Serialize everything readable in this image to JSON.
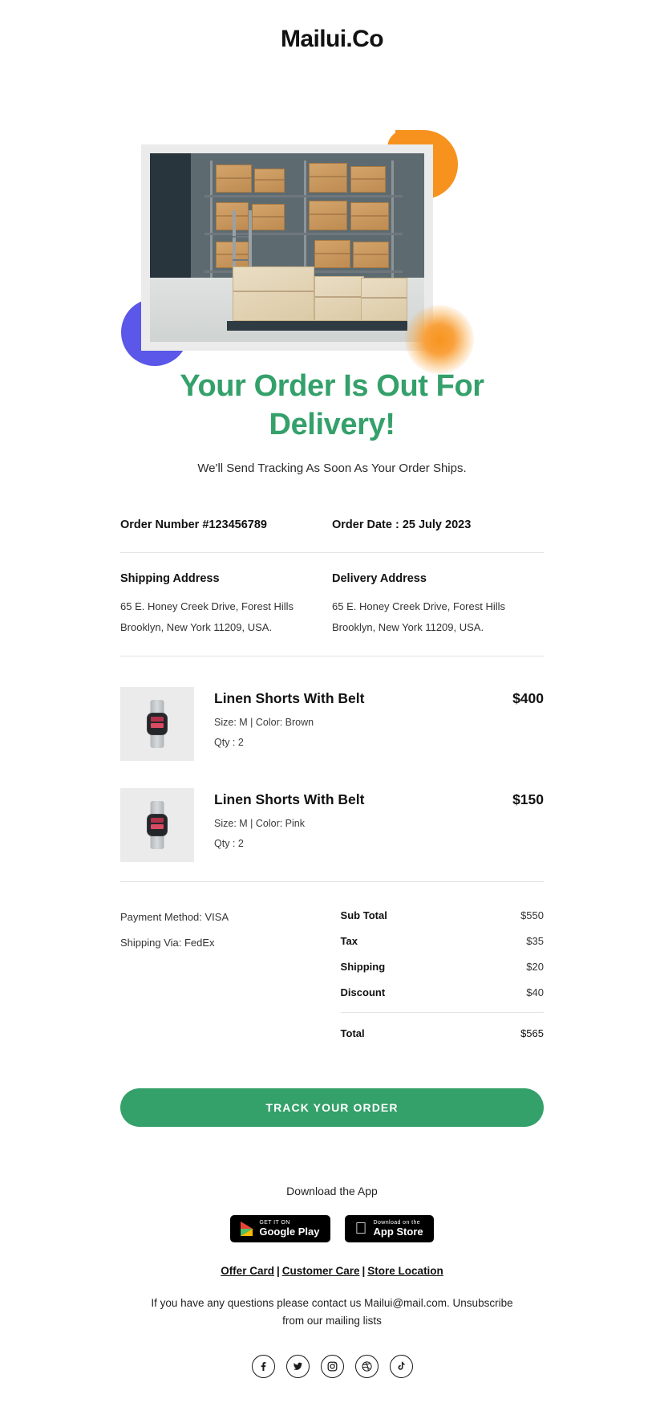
{
  "brand": {
    "logo": "Mailui.Co"
  },
  "hero": {
    "image_alt": "warehouse-boxes-photo",
    "decor": {
      "orange": "#F7921E",
      "purple": "#5B57E8",
      "glow": "#F7941E"
    }
  },
  "headline": "Your Order Is Out For Delivery!",
  "subheadline": "We'll Send Tracking As Soon As Your Order Ships.",
  "order": {
    "number_label": "Order Number #123456789",
    "date_label": "Order Date : 25 July 2023"
  },
  "addresses": {
    "shipping": {
      "title": "Shipping Address",
      "line1": "65 E. Honey Creek Drive, Forest Hills",
      "line2": "Brooklyn, New York 11209, USA."
    },
    "delivery": {
      "title": "Delivery Address",
      "line1": "65 E. Honey Creek Drive, Forest Hills",
      "line2": "Brooklyn, New York 11209, USA."
    }
  },
  "products": [
    {
      "name": "Linen Shorts With Belt",
      "attributes": "Size: M | Color: Brown",
      "qty": "Qty : 2",
      "price": "$400"
    },
    {
      "name": "Linen Shorts With Belt",
      "attributes": "Size: M | Color: Pink",
      "qty": "Qty : 2",
      "price": "$150"
    }
  ],
  "payment": {
    "method": "Payment Method: VISA",
    "shipping_via": "Shipping Via: FedEx"
  },
  "totals": {
    "rows": [
      {
        "label": "Sub Total",
        "value": "$550"
      },
      {
        "label": "Tax",
        "value": "$35"
      },
      {
        "label": "Shipping",
        "value": "$20"
      },
      {
        "label": "Discount",
        "value": "$40"
      }
    ],
    "grand": {
      "label": "Total",
      "value": "$565"
    }
  },
  "cta": {
    "label": "TRACK YOUR ORDER",
    "color": "#34A06A"
  },
  "footer": {
    "download_text": "Download the App",
    "badges": [
      {
        "small": "GET IT ON",
        "big": "Google Play",
        "icon": "google-play-icon"
      },
      {
        "small": "Download on the",
        "big": "App Store",
        "icon": "apple-icon"
      }
    ],
    "links": [
      {
        "label": "Offer Card"
      },
      {
        "label": "Customer Care"
      },
      {
        "label": "Store Location"
      }
    ],
    "link_separator": "|",
    "contact_line1": "If you have any questions please contact us Mailui@mail.com. Unsubscribe",
    "contact_line2": "from our mailing lists",
    "socials": [
      {
        "name": "facebook-icon",
        "glyph": "f"
      },
      {
        "name": "twitter-icon",
        "glyph": "t"
      },
      {
        "name": "instagram-icon",
        "glyph": "i"
      },
      {
        "name": "dribbble-icon",
        "glyph": "d"
      },
      {
        "name": "tiktok-icon",
        "glyph": "k"
      }
    ]
  }
}
